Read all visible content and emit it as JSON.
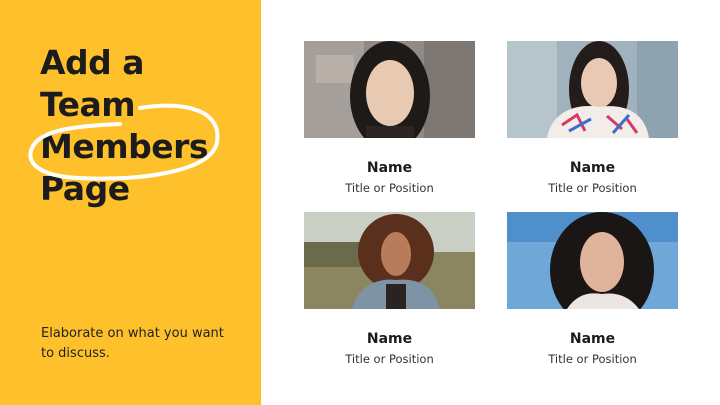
{
  "title_lines": [
    "Add a",
    "Team",
    "Members",
    "Page"
  ],
  "description": "Elaborate on what you want to discuss.",
  "members": [
    {
      "name": "Name",
      "role": "Title or Position"
    },
    {
      "name": "Name",
      "role": "Title or Position"
    },
    {
      "name": "Name",
      "role": "Title or Position"
    },
    {
      "name": "Name",
      "role": "Title or Position"
    }
  ],
  "colors": {
    "accent": "#ffc12b",
    "text": "#1c1c1c",
    "background": "#ffffff"
  }
}
